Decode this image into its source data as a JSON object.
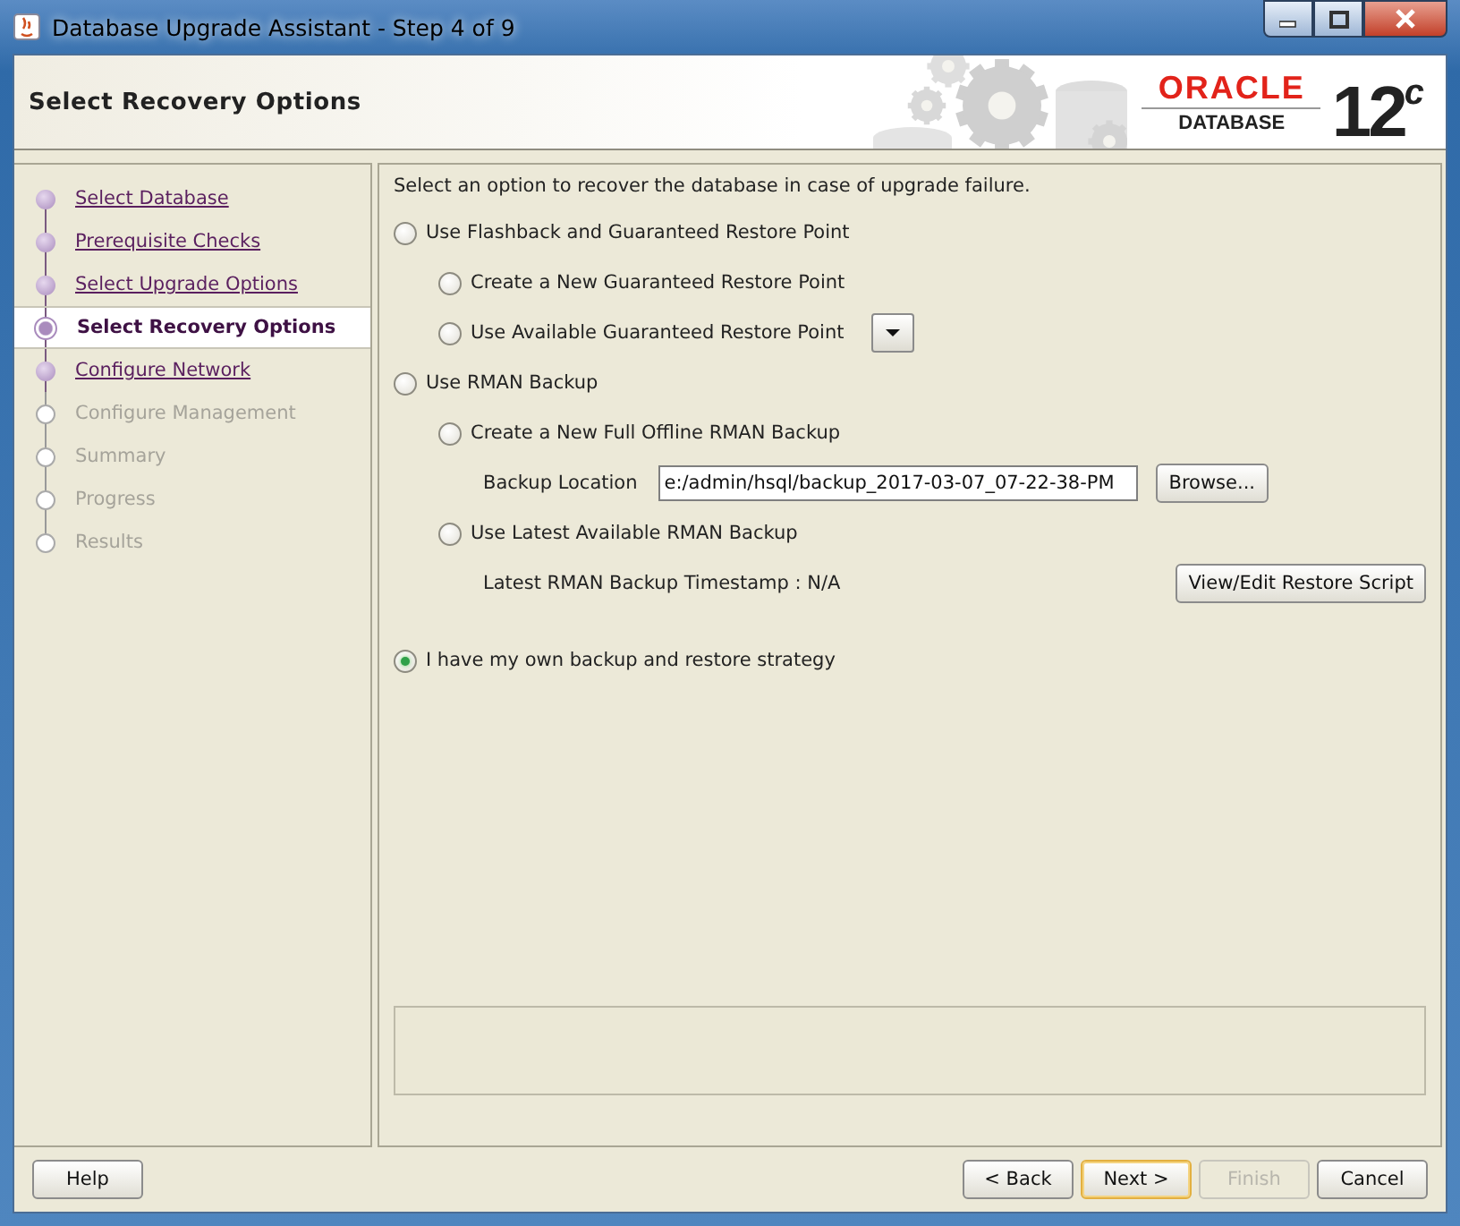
{
  "window": {
    "title": "Database Upgrade Assistant - Step 4 of 9"
  },
  "header": {
    "title": "Select Recovery Options",
    "logo": {
      "brand": "ORACLE",
      "product": "DATABASE",
      "version": "12$^{c}$"
    }
  },
  "steps": [
    {
      "label": "Select Database",
      "visited": true,
      "selected": false
    },
    {
      "label": "Prerequisite Checks",
      "visited": true,
      "selected": false
    },
    {
      "label": "Select Upgrade Options",
      "visited": true,
      "selected": false
    },
    {
      "label": "Select Recovery Options",
      "visited": true,
      "selected": true
    },
    {
      "label": "Configure Network",
      "visited": true,
      "selected": false
    },
    {
      "label": "Configure Management",
      "visited": false,
      "selected": false
    },
    {
      "label": "Summary",
      "visited": false,
      "selected": false
    },
    {
      "label": "Progress",
      "visited": false,
      "selected": false
    },
    {
      "label": "Results",
      "visited": false,
      "selected": false
    }
  ],
  "intro": "Select an option to recover the database in case of upgrade failure.",
  "options": [
    {
      "label": "Use Flashback and Guaranteed Restore Point",
      "selected": false,
      "children": [
        {
          "label": "Create a New Guaranteed Restore Point",
          "selected": false
        },
        {
          "label": "Use Available Guaranteed Restore Point",
          "selected": false,
          "dropdown": true
        }
      ]
    },
    {
      "label": "Use RMAN Backup",
      "selected": false,
      "children": [
        {
          "label": "Create a New Full Offline RMAN Backup",
          "selected": false,
          "field": {
            "label": "Backup Location",
            "value": "e:/admin/hsql/backup_2017-03-07_07-22-38-PM",
            "button": "Browse..."
          }
        },
        {
          "label": "Use Latest Available RMAN Backup",
          "selected": false,
          "note": {
            "text": "Latest RMAN Backup Timestamp : N/A",
            "button": "View/Edit Restore Script"
          }
        }
      ]
    },
    {
      "label": "I have my own backup and restore strategy",
      "selected": true
    }
  ],
  "buttons": [
    {
      "label": "Help",
      "kind": "left",
      "default": false,
      "disabled": false
    },
    {
      "label": "< Back",
      "kind": "right",
      "default": false,
      "disabled": false
    },
    {
      "label": "Next >",
      "kind": "right",
      "default": true,
      "disabled": false
    },
    {
      "label": "Finish",
      "kind": "right",
      "default": false,
      "disabled": true
    },
    {
      "label": "Cancel",
      "kind": "right",
      "default": false,
      "disabled": false
    }
  ]
}
